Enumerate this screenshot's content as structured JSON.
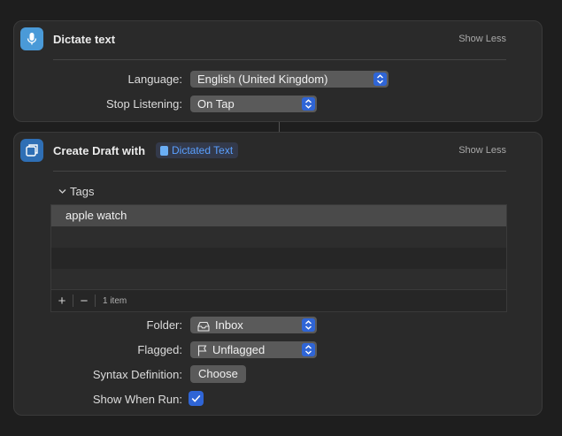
{
  "dictate": {
    "title": "Dictate text",
    "show_less": "Show Less",
    "language_label": "Language:",
    "language_value": "English (United Kingdom)",
    "stop_label": "Stop Listening:",
    "stop_value": "On Tap"
  },
  "draft": {
    "title": "Create Draft with",
    "token": "Dictated Text",
    "show_less": "Show Less",
    "tags_label": "Tags",
    "tags": [
      "apple watch"
    ],
    "item_count": "1 item",
    "add_label": "+",
    "remove_label": "−",
    "folder_label": "Folder:",
    "folder_value": "Inbox",
    "flagged_label": "Flagged:",
    "flagged_value": "Unflagged",
    "syntax_label": "Syntax Definition:",
    "syntax_button": "Choose",
    "show_when_run_label": "Show When Run:",
    "show_when_run_checked": true
  },
  "colors": {
    "accent": "#2f65d6",
    "token_text": "#5aa0ff",
    "mic_icon_bg": "#4a9ad8",
    "draft_icon_bg": "#2f6fb5"
  },
  "icons": [
    "microphone-icon",
    "drafts-app-icon",
    "chevron-down-icon",
    "inbox-tray-icon",
    "flag-icon",
    "checkmark-icon",
    "stepper-icon"
  ]
}
